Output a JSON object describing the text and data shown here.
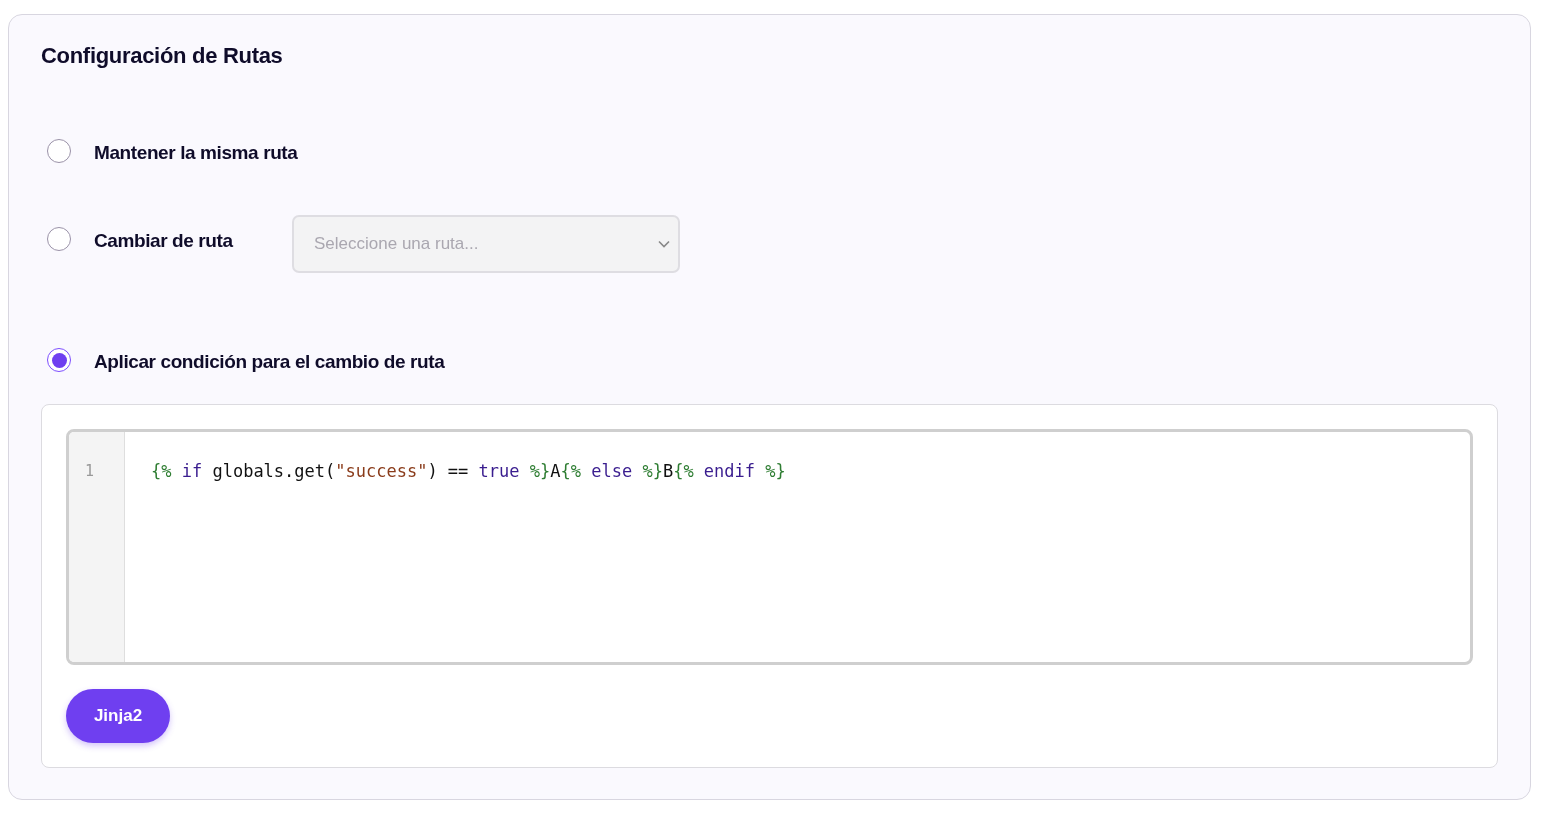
{
  "title": "Configuración de Rutas",
  "options": [
    {
      "label": "Mantener la misma ruta",
      "selected": false,
      "kind": "plain"
    },
    {
      "label": "Cambiar de ruta",
      "selected": false,
      "kind": "select",
      "placeholder": "Seleccione una ruta..."
    },
    {
      "label": "Aplicar condición para el cambio de ruta",
      "selected": true,
      "kind": "plain"
    }
  ],
  "editor": {
    "lines": [
      {
        "number": "1",
        "tokens": [
          {
            "text": "{% ",
            "kind": "tag"
          },
          {
            "text": "if",
            "kind": "keyword"
          },
          {
            "text": " globals.get(",
            "kind": "plain"
          },
          {
            "text": "\"success\"",
            "kind": "string"
          },
          {
            "text": ") == ",
            "kind": "plain"
          },
          {
            "text": "true",
            "kind": "keyword"
          },
          {
            "text": " %}",
            "kind": "tag"
          },
          {
            "text": "A",
            "kind": "plain"
          },
          {
            "text": "{% ",
            "kind": "tag"
          },
          {
            "text": "else",
            "kind": "keyword"
          },
          {
            "text": " %}",
            "kind": "tag"
          },
          {
            "text": "B",
            "kind": "plain"
          },
          {
            "text": "{% ",
            "kind": "tag"
          },
          {
            "text": "endif",
            "kind": "keyword"
          },
          {
            "text": " %}",
            "kind": "tag"
          }
        ]
      }
    ],
    "language_button": "Jinja2"
  }
}
